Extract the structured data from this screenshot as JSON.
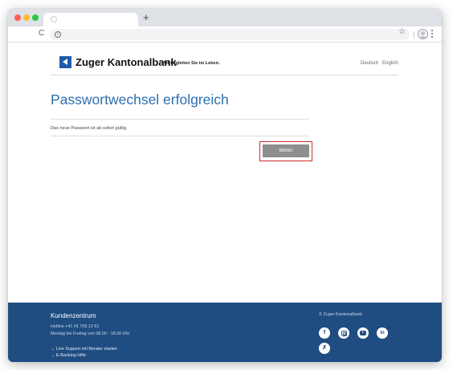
{
  "browser": {
    "new_tab_glyph": "+",
    "reload_glyph": "C",
    "info_glyph": "i",
    "star_glyph": "☆"
  },
  "header": {
    "brand": "Zuger Kantonalbank",
    "slogan": "Wir begleiten Sie im Leben.",
    "languages": [
      "Deutsch",
      "English"
    ]
  },
  "main": {
    "title": "Passwortwechsel erfolgreich",
    "message": "Das neue Passwort ist ab sofort gültig.",
    "next_button": "Weiter"
  },
  "footer": {
    "title": "Kundenzentrum",
    "hotline": "Hotline +41 41 709 12 61",
    "hours": "Montag bis Freitag von 08.00 - 18.00 Uhr",
    "links": [
      "→ Live Support mit Berater starten",
      "→ E-Banking Hilfe"
    ],
    "copyright": "© Zuger Kantonalbank",
    "social": {
      "facebook": "f",
      "linkedin": "in",
      "xing": "✗"
    }
  },
  "colors": {
    "brand_blue": "#1e5aa8",
    "title_blue": "#2d6fb0",
    "footer_bg": "#1f4d82",
    "button_grey": "#8e8e8e",
    "highlight_red": "#c9302c"
  },
  "icons": [
    "close-dot-icon",
    "minimize-dot-icon",
    "maximize-dot-icon",
    "reload-icon",
    "info-icon",
    "star-icon",
    "profile-icon",
    "menu-icon",
    "zkb-logo-icon",
    "facebook-icon",
    "instagram-icon",
    "youtube-icon",
    "linkedin-icon",
    "xing-icon"
  ]
}
